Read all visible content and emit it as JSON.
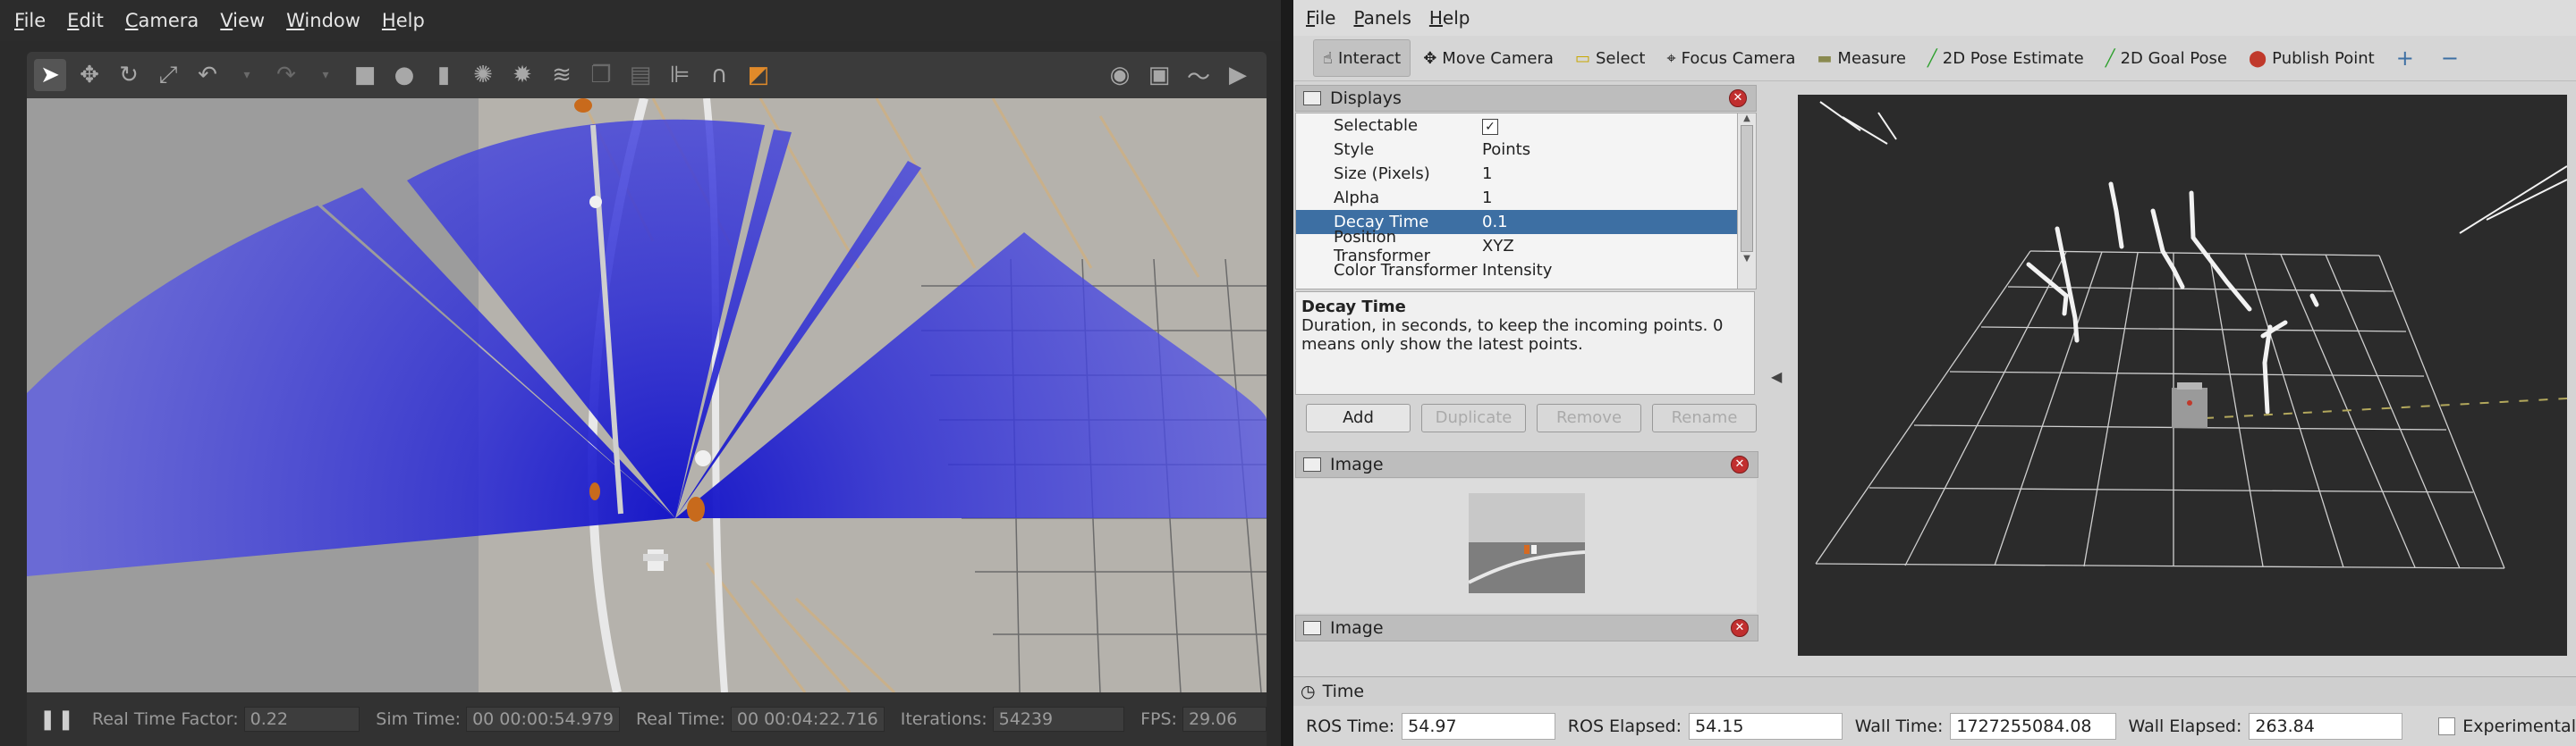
{
  "gazebo": {
    "menu": [
      "File",
      "Edit",
      "Camera",
      "View",
      "Window",
      "Help"
    ],
    "status": {
      "rtf_label": "Real Time Factor:",
      "rtf_value": "0.22",
      "sim_label": "Sim Time:",
      "sim_value": "00 00:00:54.979",
      "real_label": "Real Time:",
      "real_value": "00 00:04:22.716",
      "iter_label": "Iterations:",
      "iter_value": "54239",
      "fps_label": "FPS:",
      "fps_value": "29.06"
    }
  },
  "rviz": {
    "menu": [
      "File",
      "Panels",
      "Help"
    ],
    "tools": {
      "interact": "Interact",
      "move_camera": "Move Camera",
      "select": "Select",
      "focus_camera": "Focus Camera",
      "measure": "Measure",
      "pose_estimate": "2D Pose Estimate",
      "goal_pose": "2D Goal Pose",
      "publish_point": "Publish Point"
    },
    "displays": {
      "title": "Displays",
      "rows": [
        {
          "key": "Selectable",
          "value": "✓"
        },
        {
          "key": "Style",
          "value": "Points"
        },
        {
          "key": "Size (Pixels)",
          "value": "1"
        },
        {
          "key": "Alpha",
          "value": "1"
        },
        {
          "key": "Decay Time",
          "value": "0.1"
        },
        {
          "key": "Position Transformer",
          "value": "XYZ"
        },
        {
          "key": "Color Transformer",
          "value": "Intensity"
        }
      ],
      "desc_title": "Decay Time",
      "desc_text": "Duration, in seconds, to keep the incoming points. 0 means only show the latest points.",
      "buttons": {
        "add": "Add",
        "duplicate": "Duplicate",
        "remove": "Remove",
        "rename": "Rename"
      }
    },
    "image_panel_1": {
      "title": "Image"
    },
    "image_panel_2": {
      "title": "Image"
    },
    "time": {
      "title": "Time",
      "ros_time_label": "ROS Time:",
      "ros_time": "54.97",
      "ros_elapsed_label": "ROS Elapsed:",
      "ros_elapsed": "54.15",
      "wall_time_label": "Wall Time:",
      "wall_time": "1727255084.08",
      "wall_elapsed_label": "Wall Elapsed:",
      "wall_elapsed": "263.84",
      "experimental_label": "Experimental"
    },
    "colors": {
      "highlight": "#3d6fa3",
      "close": "#c12f2f"
    }
  }
}
